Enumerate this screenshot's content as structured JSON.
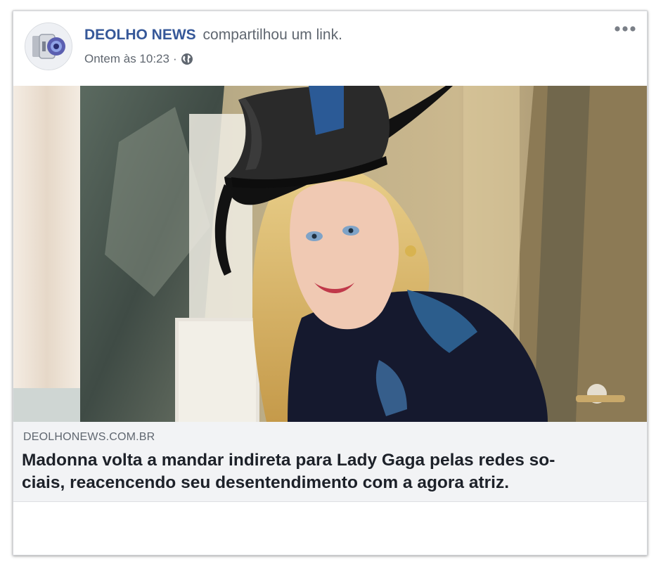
{
  "post": {
    "author": "DEOLHO NEWS",
    "action": "compartilhou um link.",
    "timestamp": "Ontem às 10:23",
    "separator": "·",
    "privacy_icon": "globe-icon",
    "more_icon": "more-options-icon"
  },
  "link": {
    "domain": "DEOLHONEWS.COM.BR",
    "headline_line1": "Madonna volta a mandar indireta para Lady Gaga pelas redes so-",
    "headline_line2": "ciais, reacencendo seu desentendimento com a agora atriz."
  },
  "colors": {
    "author_link": "#365899",
    "secondary_text": "#606770",
    "link_box_bg": "#f2f3f5",
    "headline_text": "#1d2129"
  }
}
